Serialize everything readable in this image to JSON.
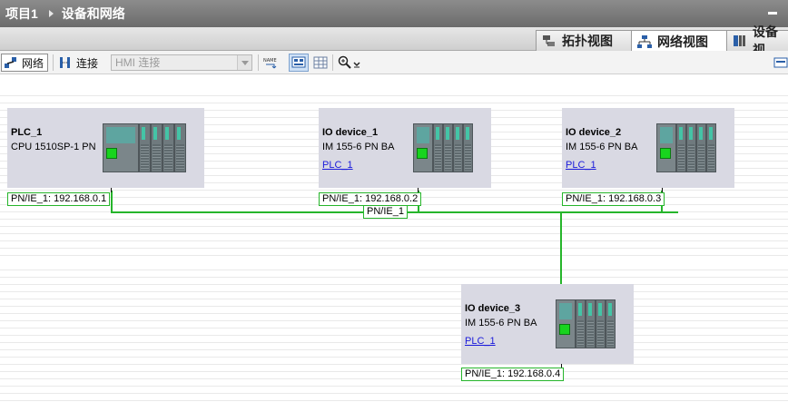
{
  "titlebar": {
    "project": "项目1",
    "page": "设备和网络"
  },
  "tabs": [
    {
      "label": "拓扑视图",
      "icon": "topology-view-icon"
    },
    {
      "label": "网络视图",
      "icon": "network-view-icon",
      "active": true
    },
    {
      "label": "设备视",
      "icon": "device-view-icon"
    }
  ],
  "toolbar": {
    "network_label": "网络",
    "connection_label": "连接",
    "connection_type_value": "HMI 连接",
    "name_icon_text": "NAME"
  },
  "devices": [
    {
      "name": "PLC_1",
      "type": "CPU 1510SP-1 PN",
      "link": "",
      "port_label": "PN/IE_1:  192.168.0.1"
    },
    {
      "name": "IO device_1",
      "type": "IM 155-6 PN BA",
      "link": "PLC_1",
      "port_label": "PN/IE_1:  192.168.0.2"
    },
    {
      "name": "IO device_2",
      "type": "IM 155-6 PN BA",
      "link": "PLC_1",
      "port_label": "PN/IE_1:  192.168.0.3"
    },
    {
      "name": "IO device_3",
      "type": "IM 155-6 PN BA",
      "link": "PLC_1",
      "port_label": "PN/IE_1:  192.168.0.4"
    }
  ],
  "network": {
    "subnet_label": "PN/IE_1",
    "line_color": "#26b52b"
  },
  "colors": {
    "titlebar": "#7a7a7a",
    "device_box": "#d9d9e3",
    "port_green": "#18d41e",
    "link_blue": "#1a1adb"
  }
}
